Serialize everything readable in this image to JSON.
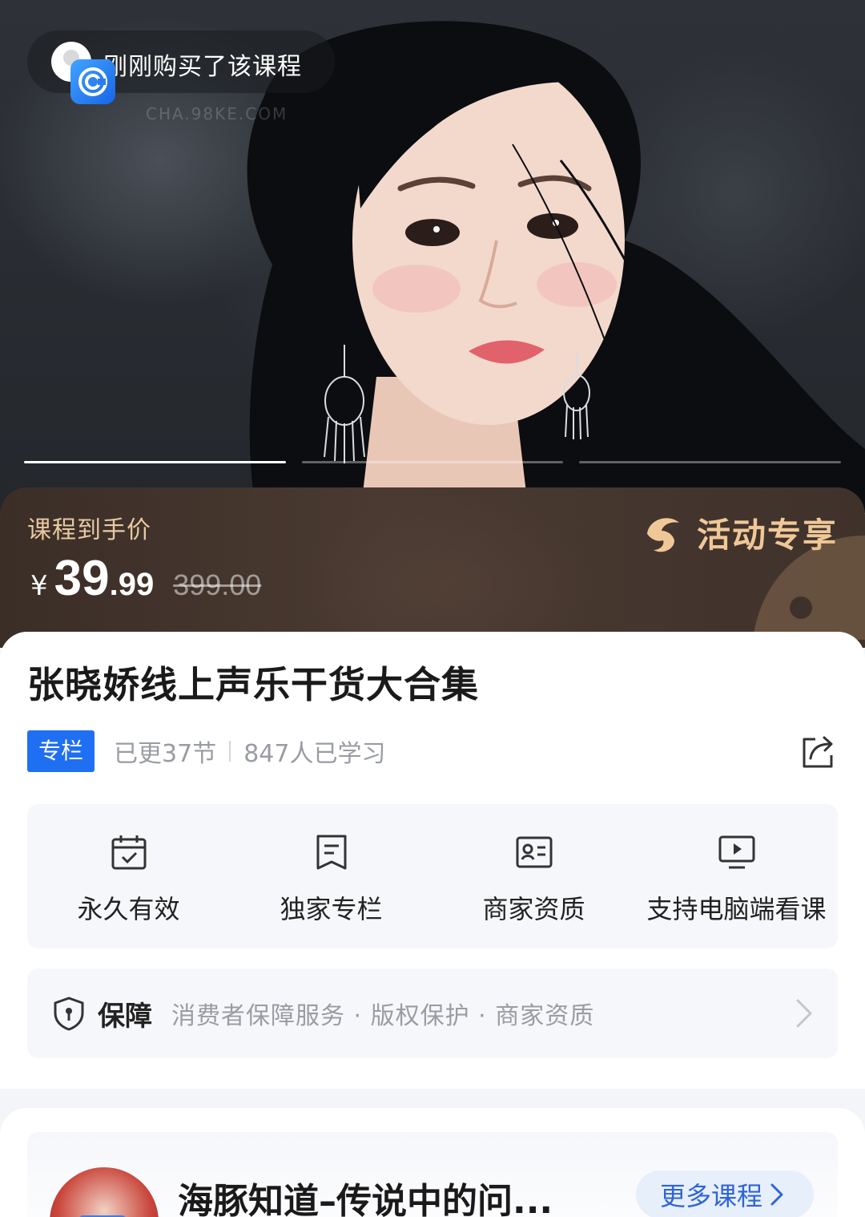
{
  "hero": {
    "recent_purchase": "刚刚购买了该课程",
    "watermark_url": "CHA.98KE.COM",
    "slides_total": 3,
    "slide_active": 1
  },
  "price": {
    "caption": "课程到手价",
    "currency": "¥",
    "integer": "39",
    "decimal": ".99",
    "original": "399.00",
    "activity_label": "活动专享"
  },
  "course": {
    "title": "张晓娇线上声乐干货大合集",
    "tag": "专栏",
    "updated": "已更37节",
    "learners": "847人已学习"
  },
  "features": [
    {
      "label": "永久有效",
      "icon": "calendar-check-icon"
    },
    {
      "label": "独家专栏",
      "icon": "column-doc-icon"
    },
    {
      "label": "商家资质",
      "icon": "id-card-icon"
    },
    {
      "label": "支持电脑端看课",
      "icon": "monitor-play-icon"
    }
  ],
  "guarantee": {
    "title": "保障",
    "items": "消费者保障服务 · 版权保护 · 商家资质"
  },
  "shop": {
    "name": "海豚知道–传说中的问...",
    "more_label": "更多课程"
  },
  "colors": {
    "accent_blue": "#1f6ff2",
    "price_gold": "#f0c898",
    "price_bar": "#4a3a31"
  }
}
